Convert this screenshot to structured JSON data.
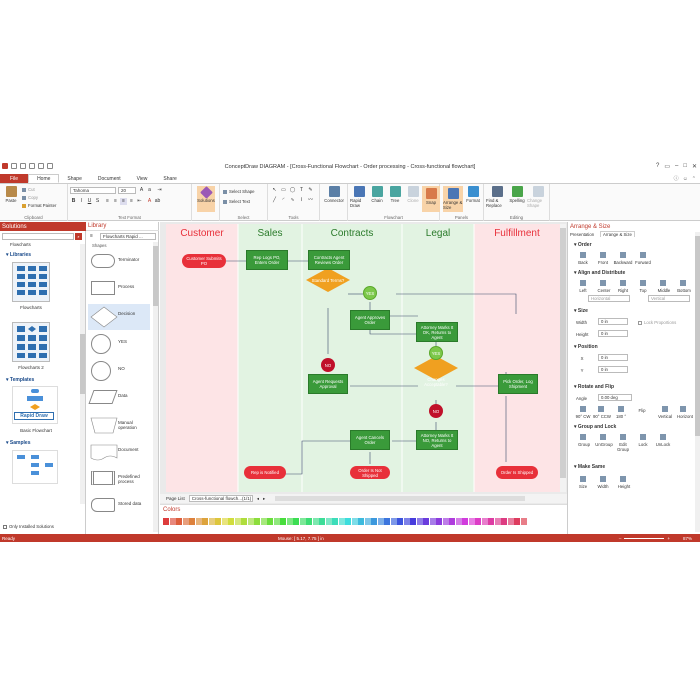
{
  "window": {
    "title": "ConceptDraw DIAGRAM - [Cross-Functional Flowchart - Order processing - Cross-functional flowchart]"
  },
  "menu_tabs": [
    "File",
    "Home",
    "Shape",
    "Document",
    "View",
    "Share"
  ],
  "ribbon": {
    "clipboard": {
      "paste": "Paste",
      "cut": "Cut",
      "copy": "Copy",
      "format_painter": "Format Painter",
      "label": "Clipboard"
    },
    "text_format": {
      "font": "Tahoma",
      "size": "20",
      "label": "Text Format"
    },
    "solutions": {
      "label": "Solutions"
    },
    "select": {
      "select_shape": "Select Shape",
      "select_text": "Select Text",
      "label": "Select"
    },
    "tools": {
      "label": "Tools"
    },
    "connector": {
      "label": "Connector"
    },
    "flowchart": {
      "rapid_draw": "Rapid Draw",
      "chain": "Chain",
      "tree": "Tree",
      "clone": "Clone",
      "snap": "Snap",
      "label": "Flowchart"
    },
    "panels": {
      "arrange_size": "Arrange & Size",
      "format": "Format",
      "label": "Panels"
    },
    "editing": {
      "find_replace": "Find & Replace",
      "spelling": "Spelling",
      "change_shape": "Change Shape",
      "label": "Editing"
    }
  },
  "solutions_panel": {
    "title": "Solutions",
    "search_value": "Flowcharts",
    "libraries_label": "Libraries",
    "templates_label": "Templates",
    "samples_label": "Samples",
    "lib_items": [
      "Flowcharts",
      "Flowcharts 2"
    ],
    "template_items": [
      "Basic Flowchart"
    ],
    "rapid_draw_badge": "Rapid Draw",
    "only_installed": "Only Installed Solutions"
  },
  "library_panel": {
    "title": "Library",
    "selected_library": "Flowcharts Rapid ...",
    "shapes_label": "Shapes",
    "shapes": [
      "Terminator",
      "Process",
      "Decision",
      "YES",
      "NO",
      "Data",
      "Manual operation",
      "Document",
      "Predefined process",
      "Stored data"
    ]
  },
  "diagram": {
    "lanes": [
      "Customer",
      "Sales",
      "Contracts",
      "Legal",
      "Fulfillment"
    ],
    "nodes": {
      "customer_submits": "Customer Submits PO",
      "rep_logs": "Rep Logs PO, Enters Order",
      "contracts_agent": "Contracts Agent Reviews Order",
      "standard_terms": "Standard Terms?",
      "yes1": "YES",
      "agent_approves": "Agent Approves Order",
      "attorney_ok": "Attorney Marks It OK, Returns to Agent",
      "no1": "NO",
      "yes2": "YES",
      "agent_requests": "Agent Requests Approval",
      "changes_acceptable": "Changes Acceptable?",
      "pick_order": "Pick Order, Log Shipment",
      "no2": "NO",
      "agent_cancels": "Agent Cancels Order",
      "attorney_no": "Attorney Marks It NO, Returns to Agent",
      "rep_notified": "Rep is Notified",
      "order_not_shipped": "Order Is Not Shipped",
      "order_shipped": "Order Is Shipped"
    }
  },
  "page_list": {
    "label": "Page List",
    "page": "Cross-functional flowch...(1/1)"
  },
  "colors_panel": {
    "title": "Colors"
  },
  "arrange_panel": {
    "title": "Arrange & Size",
    "tabs": [
      "Presentation",
      "Arrange & Size"
    ],
    "order": {
      "label": "Order",
      "items": [
        "Back",
        "Front",
        "Backward",
        "Forward"
      ]
    },
    "align": {
      "label": "Align and Distribute",
      "items": [
        "Left",
        "Center",
        "Right",
        "Top",
        "Middle",
        "Bottom"
      ],
      "horizontal": "Horizontal",
      "vertical": "Vertical"
    },
    "size": {
      "label": "Size",
      "width_label": "Width",
      "height_label": "Height",
      "width": "0 in",
      "height": "0 in",
      "lock": "Lock Proportions"
    },
    "position": {
      "label": "Position",
      "x_label": "X",
      "y_label": "Y",
      "x": "0 in",
      "y": "0 in"
    },
    "rotate": {
      "label": "Rotate and Flip",
      "angle_label": "Angle",
      "angle": "0.00 deg",
      "items": [
        "90° CW",
        "90° CCW",
        "180 °",
        "Flip",
        "Vertical",
        "Horizont"
      ]
    },
    "group": {
      "label": "Group and Lock",
      "items": [
        "Group",
        "UnGroup",
        "Edit Group",
        "Lock",
        "UnLock"
      ]
    },
    "same": {
      "label": "Make Same",
      "items": [
        "Size",
        "Width",
        "Height"
      ]
    }
  },
  "status": {
    "left": "Ready",
    "mouse": "Mouse: [ 5.17, 7.75 ] in",
    "zoom": "87%"
  },
  "colors": {
    "accent": "#c0392b",
    "green_node": "#3a9a3a",
    "red_node": "#e8303a",
    "orange_node": "#f0a020",
    "lane_pink": "#fde4e6",
    "lane_green": "#e2f3e2"
  }
}
